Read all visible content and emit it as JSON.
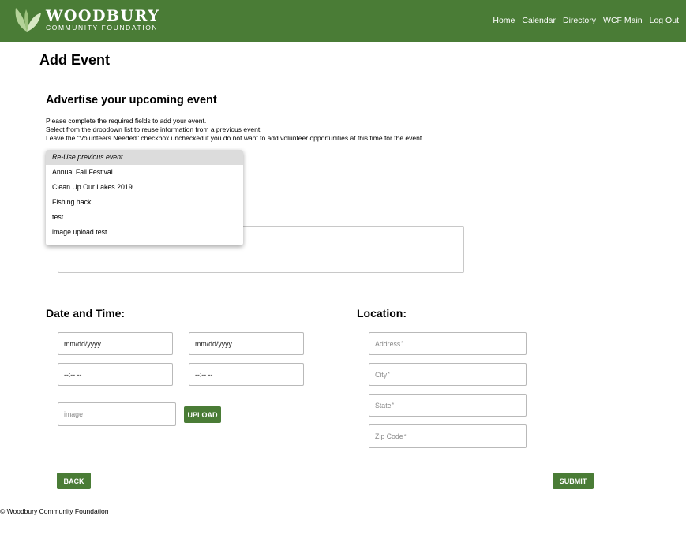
{
  "header": {
    "logo_title": "WOODBURY",
    "logo_subtitle": "COMMUNITY FOUNDATION",
    "nav": [
      "Home",
      "Calendar",
      "Directory",
      "WCF Main",
      "Log Out"
    ],
    "bg_color": "#4a7c36"
  },
  "page": {
    "title": "Add Event",
    "section_title": "Advertise your upcoming event",
    "instructions": [
      "Please complete the required fields to add your event.",
      "Select from the dropdown list to reuse information from a previous event.",
      "Leave the \"Volunteers Needed\" checkbox unchecked if you do not want to add volunteer opportunities at this time for the event."
    ]
  },
  "dropdown": {
    "selected": "Re-Use previous event",
    "options": [
      "Annual Fall Festival",
      "Clean Up Our Lakes 2019",
      "Fishing hack",
      "test",
      "image upload test"
    ]
  },
  "datetime": {
    "title": "Date and Time:",
    "start_date": "mm/dd/yyyy",
    "end_date": "mm/dd/yyyy",
    "start_time": "--:-- --",
    "end_time": "--:-- --",
    "image_placeholder": "image",
    "upload_label": "UPLOAD"
  },
  "location": {
    "title": "Location:",
    "address": "Address",
    "city": "City",
    "state": "State",
    "zip": "Zip Code",
    "required_mark": "*"
  },
  "buttons": {
    "back": "BACK",
    "submit": "SUBMIT"
  },
  "footer": {
    "text": "© Woodbury Community Foundation"
  },
  "icons": {
    "logo": "leaf-logo-icon"
  },
  "colors": {
    "accent": "#4a7c36",
    "dropdown_selected": "#dcdcdc"
  }
}
